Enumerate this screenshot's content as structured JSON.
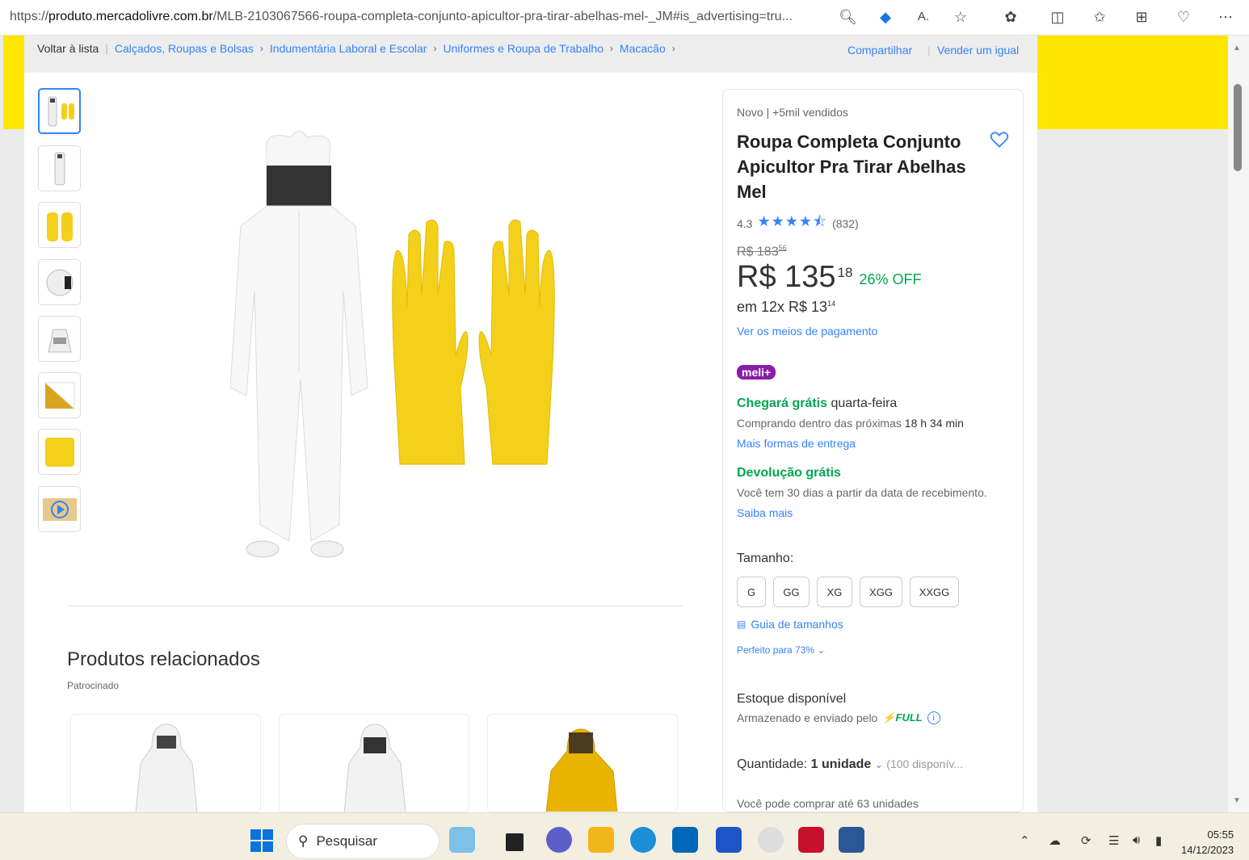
{
  "browser": {
    "url_prefix": "https://",
    "url_host": "produto.mercadolivre.com.br",
    "url_path": "/MLB-2103067566-roupa-completa-conjunto-apicultor-pra-tirar-abelhas-mel-_JM#is_advertising=tru..."
  },
  "breadcrumb": {
    "back": "Voltar à lista",
    "items": [
      "Calçados, Roupas e Bolsas",
      "Indumentária Laboral e Escolar",
      "Uniformes e Roupa de Trabalho",
      "Macacão"
    ],
    "share": "Compartilhar",
    "sell": "Vender um igual"
  },
  "product": {
    "condition": "Novo  |  +5mil vendidos",
    "title": "Roupa Completa Conjunto Apicultor Pra Tirar Abelhas Mel",
    "rating": "4.3",
    "stars": "★★★★⯪",
    "reviews": "(832)",
    "old_price": "R$ 183",
    "old_cents": "56",
    "price": "R$ 135",
    "price_cents": "18",
    "discount": "26% OFF",
    "installments": "em 12x R$ 13",
    "installment_cents": "14",
    "payment_link": "Ver os meios de pagamento",
    "meli_badge": "meli+",
    "ship_free": "Chegará grátis",
    "ship_day": " quarta-feira",
    "ship_window": "Comprando dentro das próximas ",
    "ship_time": "18 h 34 min",
    "ship_more": "Mais formas de entrega",
    "return_title": "Devolução grátis",
    "return_text": "Você tem 30 dias a partir da data de recebimento.",
    "return_link": "Saiba mais",
    "size_label": "Tamanho:",
    "sizes": [
      "G",
      "GG",
      "XG",
      "XGG",
      "XXGG"
    ],
    "size_guide": "Guia de tamanhos",
    "fit": "Perfeito para 73%",
    "stock_title": "Estoque disponível",
    "stored_by": "Armazenado e enviado pelo",
    "full": "FULL",
    "qty_label": "Quantidade: ",
    "qty_value": "1 unidade",
    "qty_available": "(100 disponív...",
    "can_buy": "Você pode comprar até 63 unidades"
  },
  "related": {
    "title": "Produtos relacionados",
    "sponsored": "Patrocinado"
  },
  "taskbar": {
    "search": "Pesquisar",
    "time": "05:55",
    "date": "14/12/2023"
  },
  "colors": {
    "accent": "#3483fa",
    "green": "#00a650",
    "brand_yellow": "#ffe600",
    "meli": "#8a1da8"
  }
}
